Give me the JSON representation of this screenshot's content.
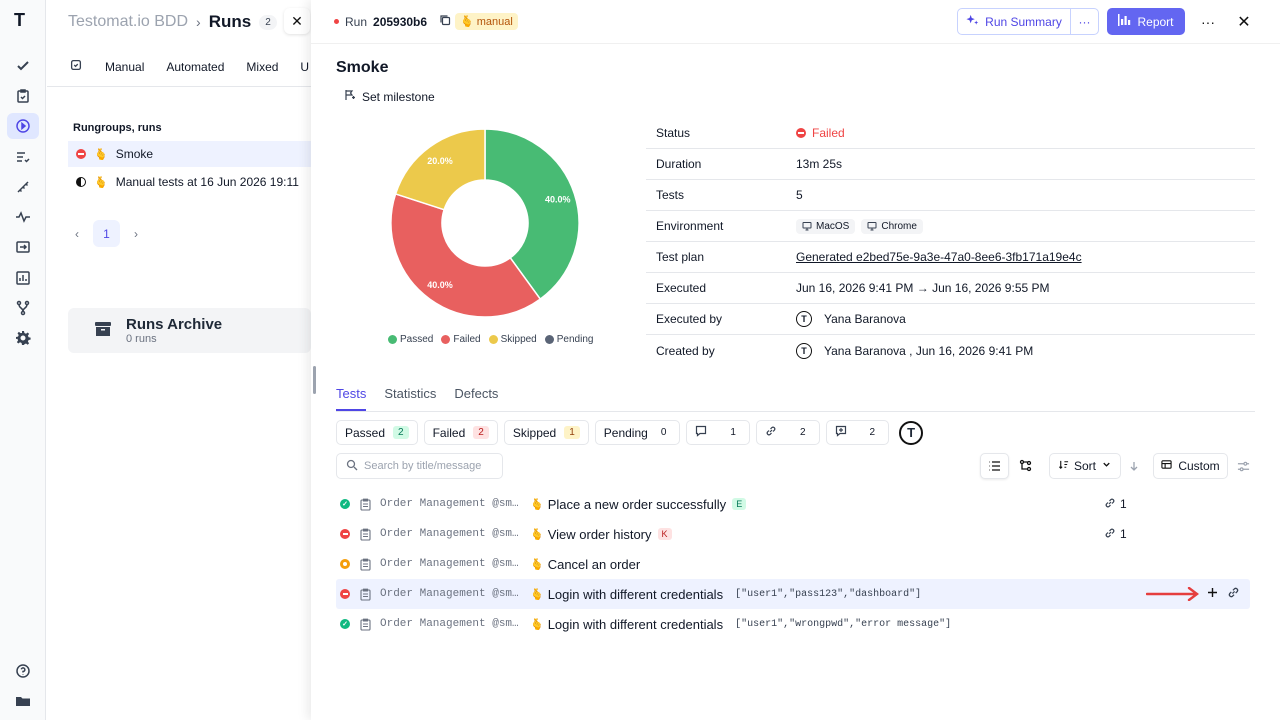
{
  "rail": {
    "logo": "T",
    "items": [
      "check-icon",
      "clipboard-check-icon",
      "play-circle-icon",
      "list-check-icon",
      "ruler-icon",
      "pulse-icon",
      "import-icon",
      "bar-chart-icon",
      "branch-icon",
      "gear-icon"
    ],
    "bottom": [
      "help-icon",
      "folder-icon"
    ]
  },
  "bg": {
    "project": "Testomat.io BDD",
    "sep": "›",
    "current": "Runs",
    "count": "2",
    "filters": [
      "Manual",
      "Automated",
      "Mixed",
      "U"
    ],
    "rungroups_title": "Rungroups, runs",
    "runs": [
      {
        "name": "Smoke",
        "status": "failed",
        "selected": true
      },
      {
        "name": "Manual tests at 16 Jun 2026 19:11",
        "status": "in-progress",
        "selected": false
      }
    ],
    "page": "1",
    "archive_title": "Runs Archive",
    "archive_count": "0 runs"
  },
  "header": {
    "run_label": "Run",
    "run_id": "205930b6",
    "badge": "manual",
    "summary_label": "Run Summary",
    "more_label": "···",
    "report_label": "Report",
    "dots": "···",
    "close": "✕"
  },
  "run": {
    "title": "Smoke",
    "milestone_label": "Set milestone"
  },
  "chart_data": {
    "type": "pie",
    "categories": [
      "Passed",
      "Failed",
      "Skipped",
      "Pending"
    ],
    "values": [
      40.0,
      40.0,
      20.0,
      0.0
    ],
    "labels": [
      "40.0%",
      "40.0%",
      "20.0%",
      ""
    ],
    "colors": [
      "#48bb74",
      "#e8605f",
      "#ecc94b",
      "#5a6476"
    ]
  },
  "info": [
    {
      "label": "Status",
      "value": "Failed"
    },
    {
      "label": "Duration",
      "value": "13m 25s"
    },
    {
      "label": "Tests",
      "value": "5"
    },
    {
      "label": "Environment",
      "env": [
        "MacOS",
        "Chrome"
      ]
    },
    {
      "label": "Test plan",
      "value": "Generated e2bed75e-9a3e-47a0-8ee6-3fb171a19e4c"
    },
    {
      "label": "Executed",
      "value": "Jun 16, 2026 9:41 PM → Jun 16, 2026 9:55 PM"
    },
    {
      "label": "Executed by",
      "value": "Yana Baranova"
    },
    {
      "label": "Created by",
      "value": "Yana Baranova , Jun 16, 2026 9:41 PM"
    }
  ],
  "tabs": [
    "Tests",
    "Statistics",
    "Defects"
  ],
  "chips": [
    {
      "label": "Passed",
      "count": "2",
      "kind": "g"
    },
    {
      "label": "Failed",
      "count": "2",
      "kind": "r"
    },
    {
      "label": "Skipped",
      "count": "1",
      "kind": "y"
    },
    {
      "label": "Pending",
      "count": "0",
      "kind": "n"
    },
    {
      "icon": "comment-icon",
      "count": "1"
    },
    {
      "icon": "link-icon",
      "count": "2"
    },
    {
      "icon": "message-plus-icon",
      "count": "2"
    }
  ],
  "search_placeholder": "Search by title/message",
  "toolbar": {
    "sort_label": "Sort",
    "custom_label": "Custom"
  },
  "tests": [
    {
      "status": "passed",
      "suite": "Order Management @sm…",
      "name": "Place a new order successfully",
      "tag": "E",
      "tagk": "e",
      "params": "",
      "links": "1"
    },
    {
      "status": "failed",
      "suite": "Order Management @sm…",
      "name": "View order history",
      "tag": "K",
      "tagk": "k",
      "params": "",
      "links": "1"
    },
    {
      "status": "pending",
      "suite": "Order Management @sm…",
      "name": "Cancel an order",
      "tag": "",
      "tagk": "",
      "params": "",
      "links": ""
    },
    {
      "status": "failed",
      "suite": "Order Management @sm…",
      "name": "Login with different credentials",
      "tag": "",
      "tagk": "",
      "params": "[\"user1\",\"pass123\",\"dashboard\"]",
      "links": "",
      "highlight": true
    },
    {
      "status": "passed",
      "suite": "Order Management @sm…",
      "name": "Login with different credentials",
      "tag": "",
      "tagk": "",
      "params": "[\"user1\",\"wrongpwd\",\"error message\"]",
      "links": ""
    }
  ],
  "accent": "#4f46e5",
  "arrow_color": "#e53e3e"
}
